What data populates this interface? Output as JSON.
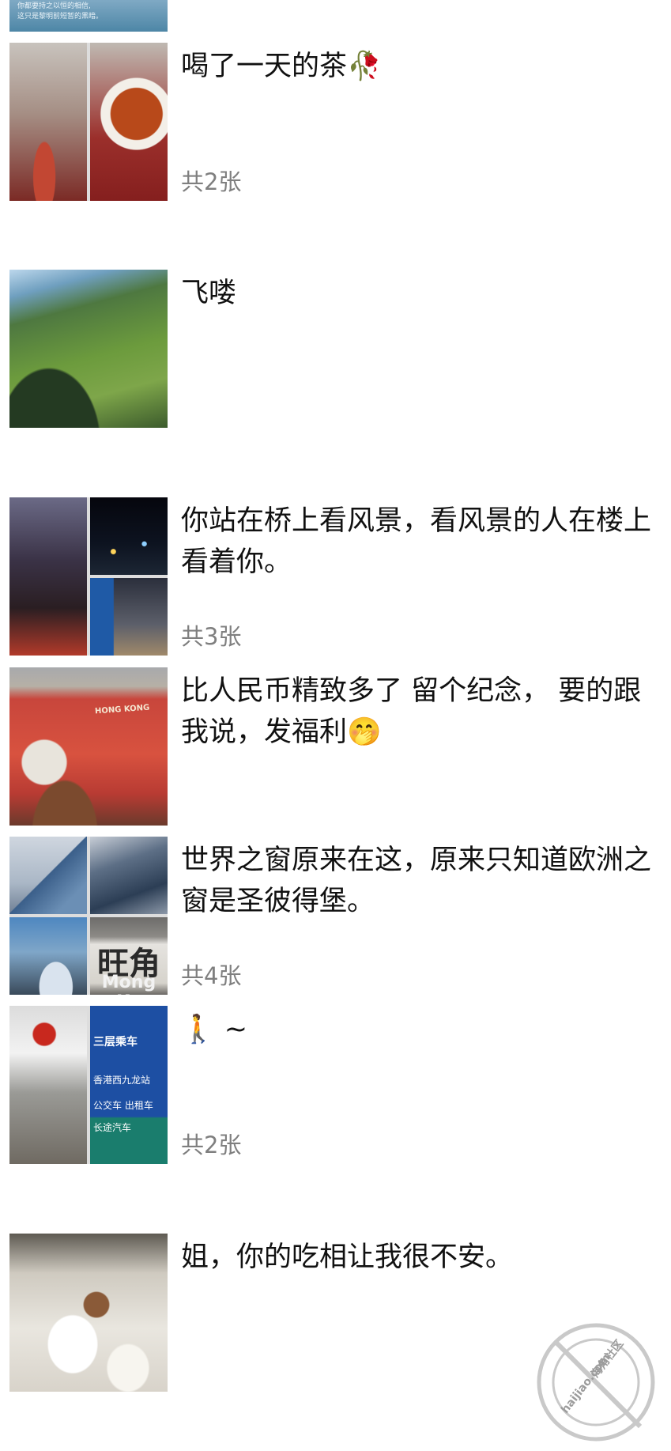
{
  "previous_post": {
    "caption_line1": "你都要持之以恒的相信,",
    "caption_line2": "这只是黎明前短暂的黑暗。"
  },
  "posts": [
    {
      "text": "喝了一天的茶🥀",
      "count": "共2张",
      "photos": [
        "tea-cup-photo",
        "tea-bowl-photo"
      ]
    },
    {
      "text": "飞喽",
      "count": "",
      "photos": [
        "aerial-view-photo"
      ]
    },
    {
      "text": "你站在桥上看风景，看风景的人在楼上看着你。",
      "count": "共3张",
      "photos": [
        "city-street-photo",
        "night-harbor-photo",
        "city-square-photo"
      ]
    },
    {
      "text": "比人民币精致多了  留个纪念，  要的跟我说，发福利🤭",
      "count": "",
      "photos": [
        "hong-kong-banknote-photo"
      ],
      "banknote_label": "HONG KONG"
    },
    {
      "text": "世界之窗原来在这，原来只知道欧洲之窗是圣彼得堡。",
      "count": "共4张",
      "photos": [
        "glass-pyramid-photo",
        "tower-photo",
        "harbor-photo",
        "mongkok-sign-photo"
      ],
      "sign_line1": "旺角",
      "sign_line2": "Mong Ko"
    },
    {
      "text": "🚶 ~",
      "count": "共2张",
      "photos": [
        "station-hall-photo",
        "station-sign-photo"
      ],
      "station_sign_line1": "三层乘车",
      "station_sign_line2": "香港西九龙站",
      "station_sign_line3": "公交车  出租车",
      "station_sign_line4": "长途汽车"
    },
    {
      "text": "姐，你的吃相让我很不安。",
      "count": "",
      "photos": [
        "dining-table-photo"
      ]
    }
  ],
  "watermark": {
    "cn": "海角社区",
    "en": "haijiao.com"
  }
}
